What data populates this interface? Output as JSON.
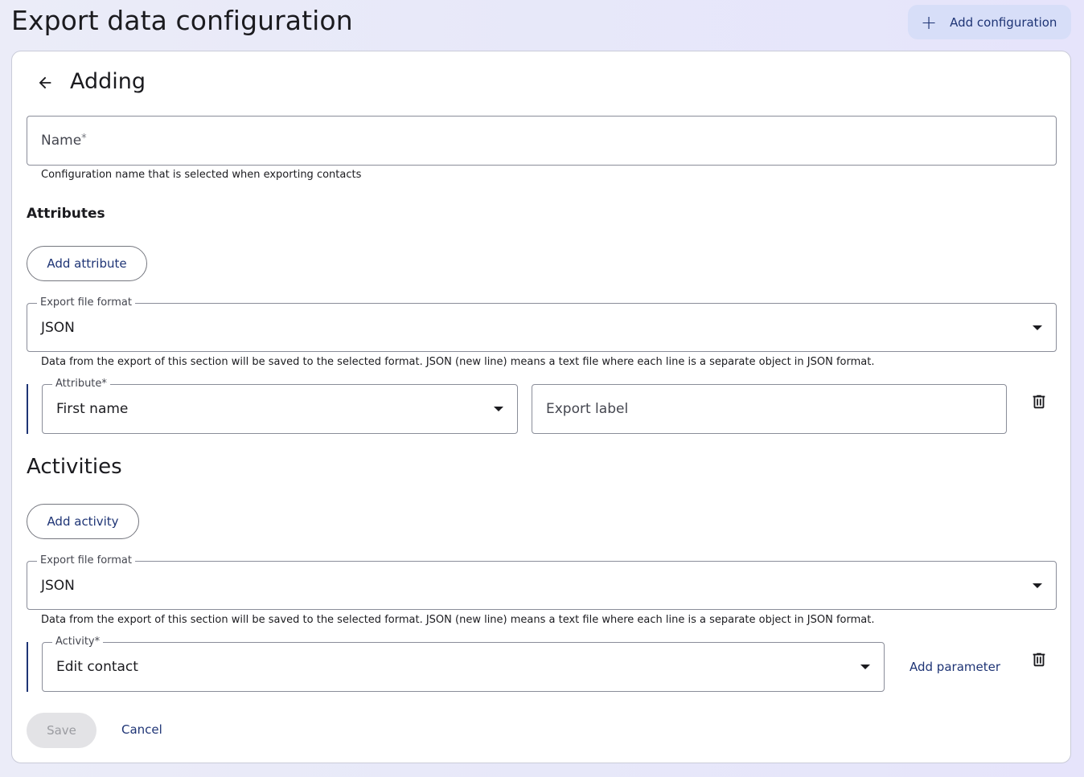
{
  "header": {
    "title": "Export data configuration",
    "add_button_icon": "plus-icon",
    "add_button_label": "Add configuration"
  },
  "form": {
    "back_icon": "arrow-left-icon",
    "title": "Adding",
    "name_field": {
      "label": "Name",
      "required_mark": "*",
      "value": "",
      "helper": "Configuration name that is selected when exporting contacts"
    },
    "attributes": {
      "section_label": "Attributes",
      "add_button": "Add attribute",
      "format_field": {
        "label": "Export file format",
        "value": "JSON",
        "helper": "Data from the export of this section will be saved to the selected format. JSON (new line) means a text file where each line is a separate object in JSON format."
      },
      "rows": [
        {
          "attribute_label": "Attribute",
          "required_mark": "*",
          "attribute_value": "First name",
          "export_label_placeholder": "Export label",
          "delete_icon": "trash-icon"
        }
      ]
    },
    "activities": {
      "section_heading": "Activities",
      "add_button": "Add activity",
      "format_field": {
        "label": "Export file format",
        "value": "JSON",
        "helper": "Data from the export of this section will be saved to the selected format. JSON (new line) means a text file where each line is a separate object in JSON format."
      },
      "rows": [
        {
          "activity_label": "Activity",
          "required_mark": "*",
          "activity_value": "Edit contact",
          "add_parameter": "Add parameter",
          "delete_icon": "trash-icon"
        }
      ]
    },
    "actions": {
      "save": "Save",
      "cancel": "Cancel"
    }
  },
  "colors": {
    "accent": "#1e3475",
    "primary_container": "#d7def8",
    "outline": "#8a8d99",
    "disabled_bg": "#e3e3e6"
  }
}
